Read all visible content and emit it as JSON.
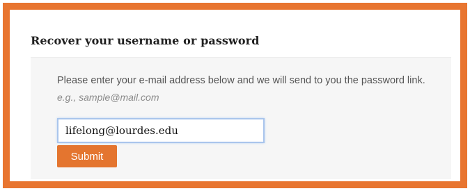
{
  "form": {
    "title": "Recover your username or password",
    "instructions": "Please enter your e-mail address below and we will send to you the password link.",
    "example": "e.g., sample@mail.com",
    "email_value": "lifelong@lourdes.edu",
    "submit_label": "Submit"
  },
  "colors": {
    "frame": "#e87530",
    "button": "#e4752f",
    "input_focus_border": "#a9c5ec"
  }
}
